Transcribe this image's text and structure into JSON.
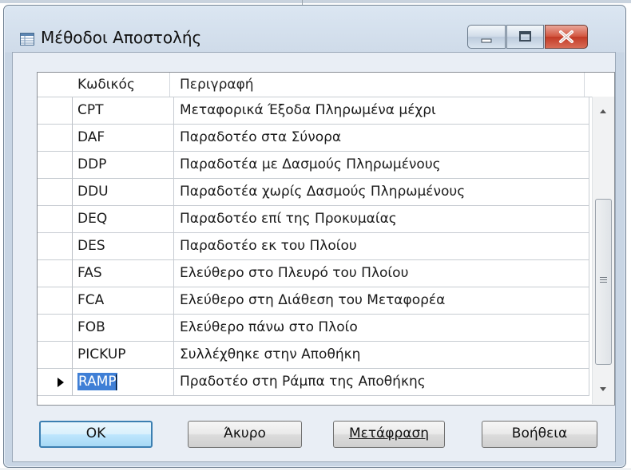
{
  "window": {
    "title": "Μέθοδοι Αποστολής"
  },
  "grid": {
    "columns": [
      "Κωδικός",
      "Περιγραφή"
    ],
    "rows": [
      {
        "code": "CPT",
        "description": "Μεταφορικά Έξοδα Πληρωμένα μέχρι"
      },
      {
        "code": "DAF",
        "description": "Παραδοτέο στα Σύνορα"
      },
      {
        "code": "DDP",
        "description": "Παραδοτέα με Δασμούς Πληρωμένους"
      },
      {
        "code": "DDU",
        "description": "Παραδοτέα χωρίς Δασμούς Πληρωμένους"
      },
      {
        "code": "DEQ",
        "description": "Παραδοτέο επί της Προκυμαίας"
      },
      {
        "code": "DES",
        "description": "Παραδοτέο εκ του Πλοίου"
      },
      {
        "code": "FAS",
        "description": "Ελεύθερο στο Πλευρό του Πλοίου"
      },
      {
        "code": "FCA",
        "description": "Ελεύθερο στη Διάθεση του Μεταφορέα"
      },
      {
        "code": "FOB",
        "description": "Ελεύθερο πάνω στο Πλοίο"
      },
      {
        "code": "PICKUP",
        "description": "Συλλέχθηκε στην Αποθήκη"
      },
      {
        "code": "RAMP",
        "description": "Πραδοτέο στη Ράμπα της Αποθήκης"
      }
    ],
    "selected_row_index": 10
  },
  "buttons": {
    "ok": "OK",
    "cancel": "Άκυρο",
    "translate": "Μετάφραση",
    "help": "Βοήθεια"
  },
  "colors": {
    "selection": "#3f7fd6",
    "close_button": "#c23a26",
    "ok_border": "#3c7fb1"
  },
  "icons": {
    "title": "table-window-icon",
    "minimize": "minimize-icon",
    "maximize": "maximize-icon",
    "close": "close-icon",
    "row_pointer": "row-pointer-icon",
    "scroll_up": "scroll-up-arrow-icon",
    "scroll_down": "scroll-down-arrow-icon",
    "scroll_grip": "scroll-grip-icon"
  }
}
